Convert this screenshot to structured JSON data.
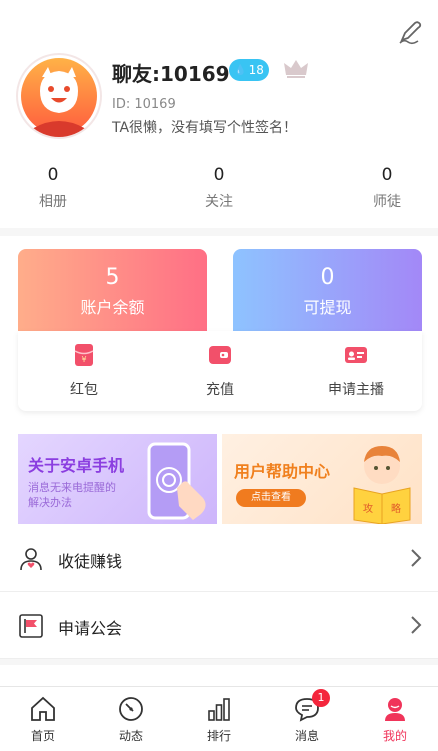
{
  "profile": {
    "nickname": "聊友:10169",
    "level": "18",
    "user_id": "ID: 10169",
    "signature": "TA很懒，没有填写个性签名！"
  },
  "stats": [
    {
      "value": "0",
      "label": "相册"
    },
    {
      "value": "0",
      "label": "关注"
    },
    {
      "value": "0",
      "label": "师徒"
    }
  ],
  "wallet": {
    "balance_value": "5",
    "balance_label": "账户余额",
    "withdraw_value": "0",
    "withdraw_label": "可提现"
  },
  "actions": [
    {
      "label": "红包",
      "icon": "red-packet-icon"
    },
    {
      "label": "充值",
      "icon": "recharge-icon"
    },
    {
      "label": "申请主播",
      "icon": "anchor-card-icon"
    }
  ],
  "banners": {
    "left_title": "关于安卓手机",
    "left_sub": "消息无来电提醒的解决办法",
    "right_title": "用户帮助中心",
    "right_button": "点击查看",
    "book_chars": [
      "攻",
      "略"
    ]
  },
  "menu": [
    {
      "label": "收徒赚钱",
      "icon": "user-heart-icon"
    },
    {
      "label": "申请公会",
      "icon": "flag-icon"
    }
  ],
  "tabbar": {
    "items": [
      {
        "label": "首页",
        "icon": "home-icon"
      },
      {
        "label": "动态",
        "icon": "compass-icon"
      },
      {
        "label": "排行",
        "icon": "ranking-icon"
      },
      {
        "label": "消息",
        "icon": "message-icon",
        "badge": "1"
      },
      {
        "label": "我的",
        "icon": "profile-icon"
      }
    ],
    "active_index": 4
  },
  "colors": {
    "accent": "#f0345a",
    "balance_gradient": [
      "#ffad8a",
      "#ff6f85"
    ],
    "withdraw_gradient": [
      "#8ec3ff",
      "#a388f7"
    ],
    "level_badge": "#39c4f3"
  }
}
